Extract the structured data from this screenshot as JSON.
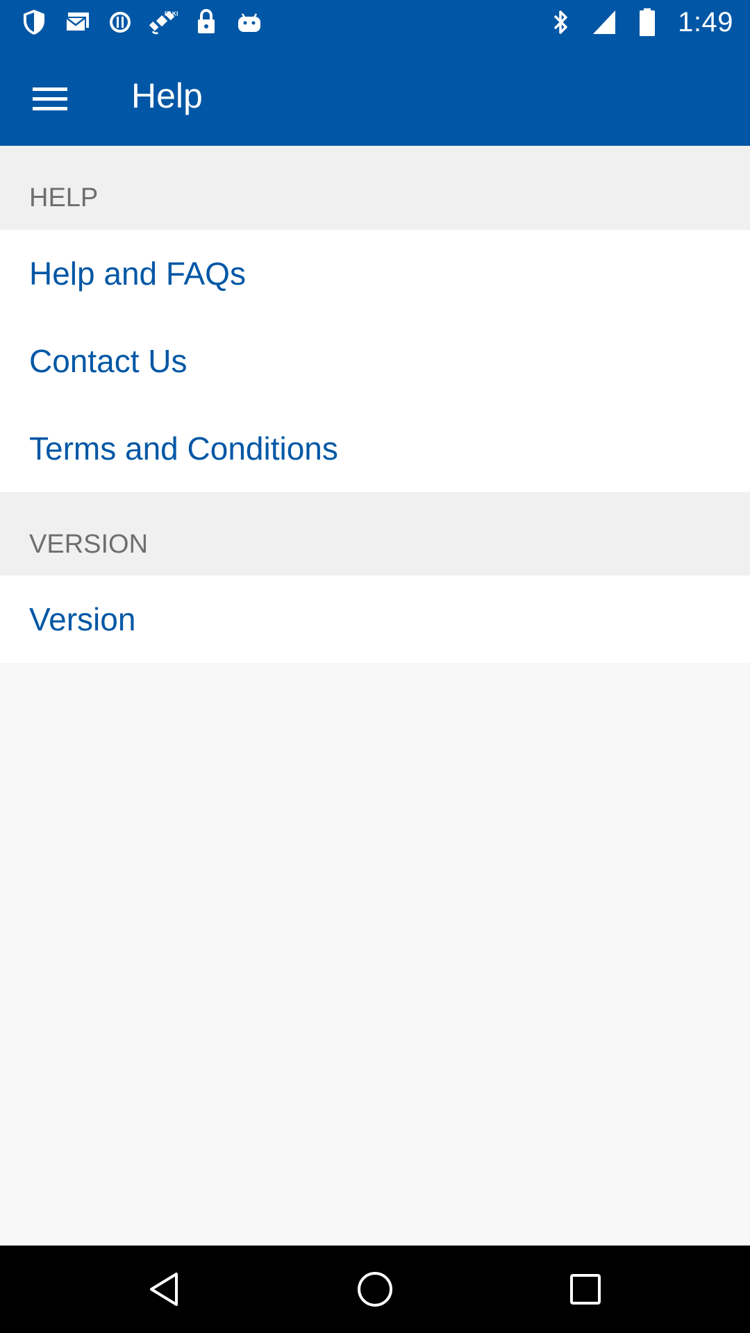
{
  "status_bar": {
    "time": "1:49",
    "icons": [
      "shield-icon",
      "mail-icon",
      "info-icon",
      "satellite-icon",
      "lock-icon",
      "android-icon",
      "bluetooth-icon",
      "signal-icon",
      "battery-icon"
    ]
  },
  "app_bar": {
    "title": "Help",
    "menu_icon": "hamburger-menu-icon"
  },
  "sections": {
    "help": {
      "header": "HELP",
      "items": [
        {
          "label": "Help and FAQs"
        },
        {
          "label": "Contact Us"
        },
        {
          "label": "Terms and Conditions"
        }
      ]
    },
    "version": {
      "header": "VERSION",
      "items": [
        {
          "label": "Version"
        }
      ]
    }
  },
  "nav_bar": {
    "icons": [
      "back-icon",
      "home-icon",
      "recents-icon"
    ]
  },
  "colors": {
    "primary": "#0157a5",
    "section_header_bg": "#f0f0f0",
    "section_header_text": "#6e6e6e",
    "page_bg": "#f8f8f8"
  }
}
